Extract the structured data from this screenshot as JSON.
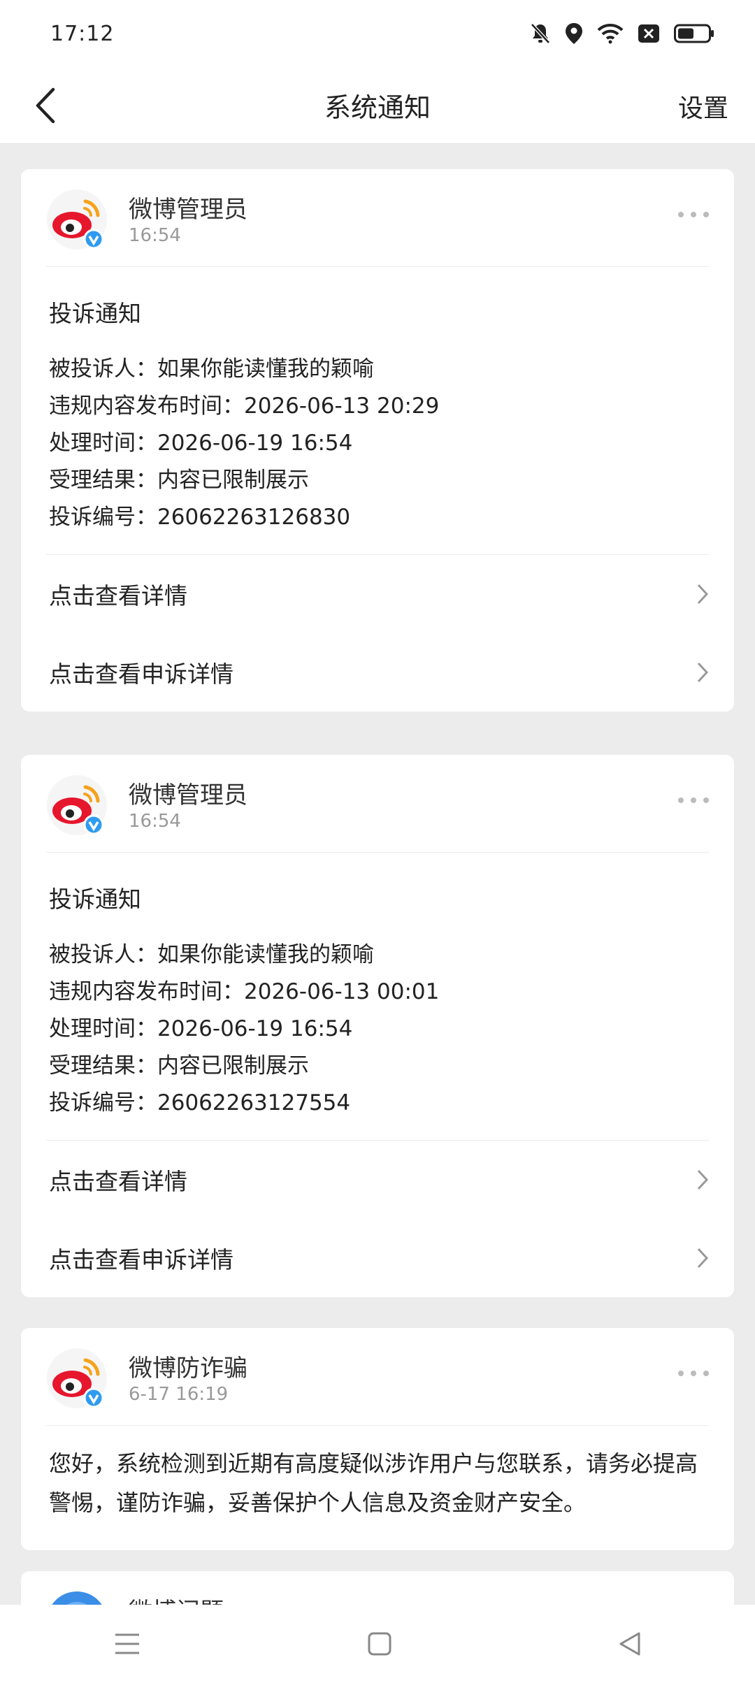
{
  "status_bar": {
    "time": "17:12",
    "icons": [
      "bell-muted-icon",
      "location-pin-icon",
      "wifi-icon",
      "close-box-icon",
      "battery-icon"
    ]
  },
  "nav": {
    "title": "系统通知",
    "settings_label": "设置"
  },
  "cards": [
    {
      "sender": "微博管理员",
      "time": "16:54",
      "title": "投诉通知",
      "lines": [
        "被投诉人：如果你能读懂我的颖喻",
        "违规内容发布时间：2026-06-13 20:29",
        "处理时间：2026-06-19 16:54",
        "受理结果：内容已限制展示",
        "投诉编号：26062263126830"
      ],
      "links": [
        "点击查看详情",
        "点击查看申诉详情"
      ]
    },
    {
      "sender": "微博管理员",
      "time": "16:54",
      "title": "投诉通知",
      "lines": [
        "被投诉人：如果你能读懂我的颖喻",
        "违规内容发布时间：2026-06-13 00:01",
        "处理时间：2026-06-19 16:54",
        "受理结果：内容已限制展示",
        "投诉编号：26062263127554"
      ],
      "links": [
        "点击查看详情",
        "点击查看申诉详情"
      ]
    },
    {
      "sender": "微博防诈骗",
      "time": "6-17 16:19",
      "message": "您好，系统检测到近期有高度疑似涉诈用户与您联系，请务必提高警惕，谨防诈骗，妥善保护个人信息及资金财产安全。"
    },
    {
      "sender": "微博问题",
      "time": ""
    }
  ],
  "colors": {
    "weibo_red": "#e6162d",
    "weibo_orange": "#f7a21b",
    "verified_blue": "#2f9bf0"
  }
}
